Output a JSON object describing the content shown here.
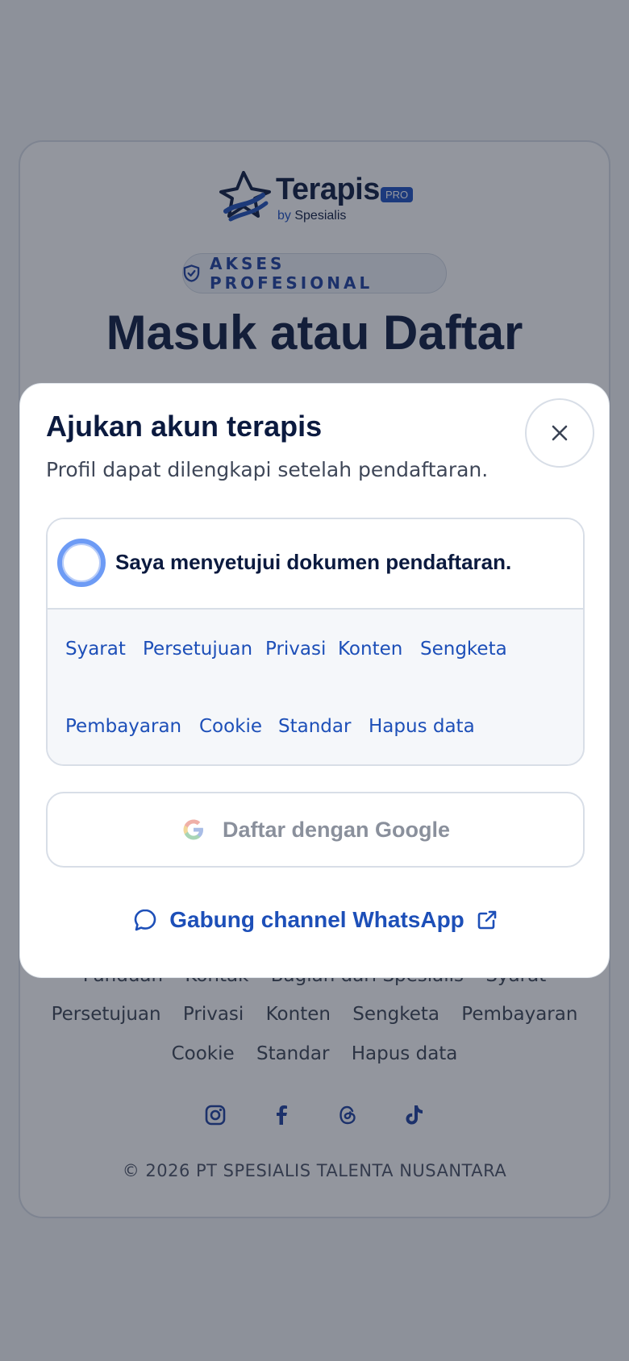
{
  "brand": {
    "name": "Terapis",
    "badge": "PRO",
    "by_prefix": "by",
    "by_name": "Spesialis"
  },
  "access_badge": {
    "label": "AKSES PROFESIONAL",
    "icon": "shield-check-icon"
  },
  "page_title": "Masuk atau Daftar",
  "footer": {
    "links_row1": [
      "Panduan",
      "Kontak",
      "Bagian dari Spesialis",
      "Syarat"
    ],
    "links_row2": [
      "Persetujuan",
      "Privasi",
      "Konten",
      "Sengketa",
      "Pembayaran"
    ],
    "links_row3": [
      "Cookie",
      "Standar",
      "Hapus data"
    ],
    "socials": [
      "instagram-icon",
      "facebook-icon",
      "threads-icon",
      "tiktok-icon"
    ],
    "copyright": "© 2026 PT SPESIALIS TALENTA NUSANTARA"
  },
  "modal": {
    "title": "Ajukan akun terapis",
    "subtitle": "Profil dapat dilengkapi setelah pendaftaran.",
    "close_icon": "close-icon",
    "consent_label": "Saya menyetujui dokumen pendaftaran.",
    "consent_checked": false,
    "documents": [
      "Syarat",
      "Persetujuan",
      "Privasi",
      "Konten",
      "Sengketa",
      "Pembayaran",
      "Cookie",
      "Standar",
      "Hapus data"
    ],
    "google_button": "Daftar dengan Google",
    "whatsapp_link": "Gabung channel WhatsApp"
  },
  "colors": {
    "primary": "#1d4fb8",
    "navy": "#0b1a3f",
    "overlay": "#8d919b"
  }
}
